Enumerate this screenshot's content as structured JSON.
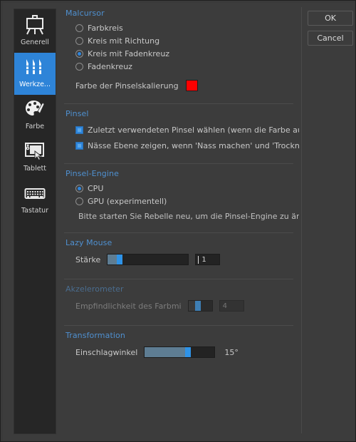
{
  "colors": {
    "accent": "#2e86de",
    "section_header": "#4f90d0",
    "brush_scaling_swatch": "#ff0000",
    "sidebar_selected": "#2e84d8",
    "window_background": "#3c3c3c",
    "sidebar_background": "#262626"
  },
  "sidebar": {
    "items": [
      {
        "label": "Generell",
        "icon": "easel-icon",
        "selected": false
      },
      {
        "label": "Werkze...",
        "icon": "brushes-icon",
        "selected": true
      },
      {
        "label": "Farbe",
        "icon": "palette-icon",
        "selected": false
      },
      {
        "label": "Tablett",
        "icon": "tablet-icon",
        "selected": false
      },
      {
        "label": "Tastatur",
        "icon": "keyboard-icon",
        "selected": false
      }
    ]
  },
  "buttons": {
    "ok": "OK",
    "cancel": "Cancel"
  },
  "sections": {
    "malcursor": {
      "title": "Malcursor",
      "options": [
        {
          "label": "Farbkreis",
          "selected": false
        },
        {
          "label": "Kreis mit Richtung",
          "selected": false
        },
        {
          "label": "Kreis mit Fadenkreuz",
          "selected": true
        },
        {
          "label": "Fadenkreuz",
          "selected": false
        }
      ],
      "swatch_label": "Farbe der Pinselskalierung",
      "swatch_color": "#ff0000"
    },
    "pinsel": {
      "title": "Pinsel",
      "checkboxes": [
        {
          "label": "Zuletzt verwendeten Pinsel wählen (wenn die Farbe aus ei",
          "checked": true
        },
        {
          "label": "Nässe Ebene zeigen, wenn 'Nass machen' und 'Trocknen'-",
          "checked": true
        }
      ]
    },
    "pinsel_engine": {
      "title": "Pinsel-Engine",
      "options": [
        {
          "label": "CPU",
          "selected": true
        },
        {
          "label": "GPU (experimentell)",
          "selected": false
        }
      ],
      "note": "Bitte starten Sie Rebelle neu, um die Pinsel-Engine zu ände"
    },
    "lazy_mouse": {
      "title": "Lazy Mouse",
      "slider_label": "Stärke",
      "slider_value": "1",
      "slider_percent": 4,
      "input_value": "1",
      "enabled": true
    },
    "akzelerometer": {
      "title": "Akzelerometer",
      "slider_label": "Empfindlichkeit des Farbmi",
      "slider_value": "4",
      "slider_percent": 13,
      "input_value": "4",
      "enabled": false
    },
    "transformation": {
      "title": "Transformation",
      "slider_label": "Einschlagwinkel",
      "slider_percent": 61,
      "value_display": "15°",
      "enabled": true
    }
  }
}
